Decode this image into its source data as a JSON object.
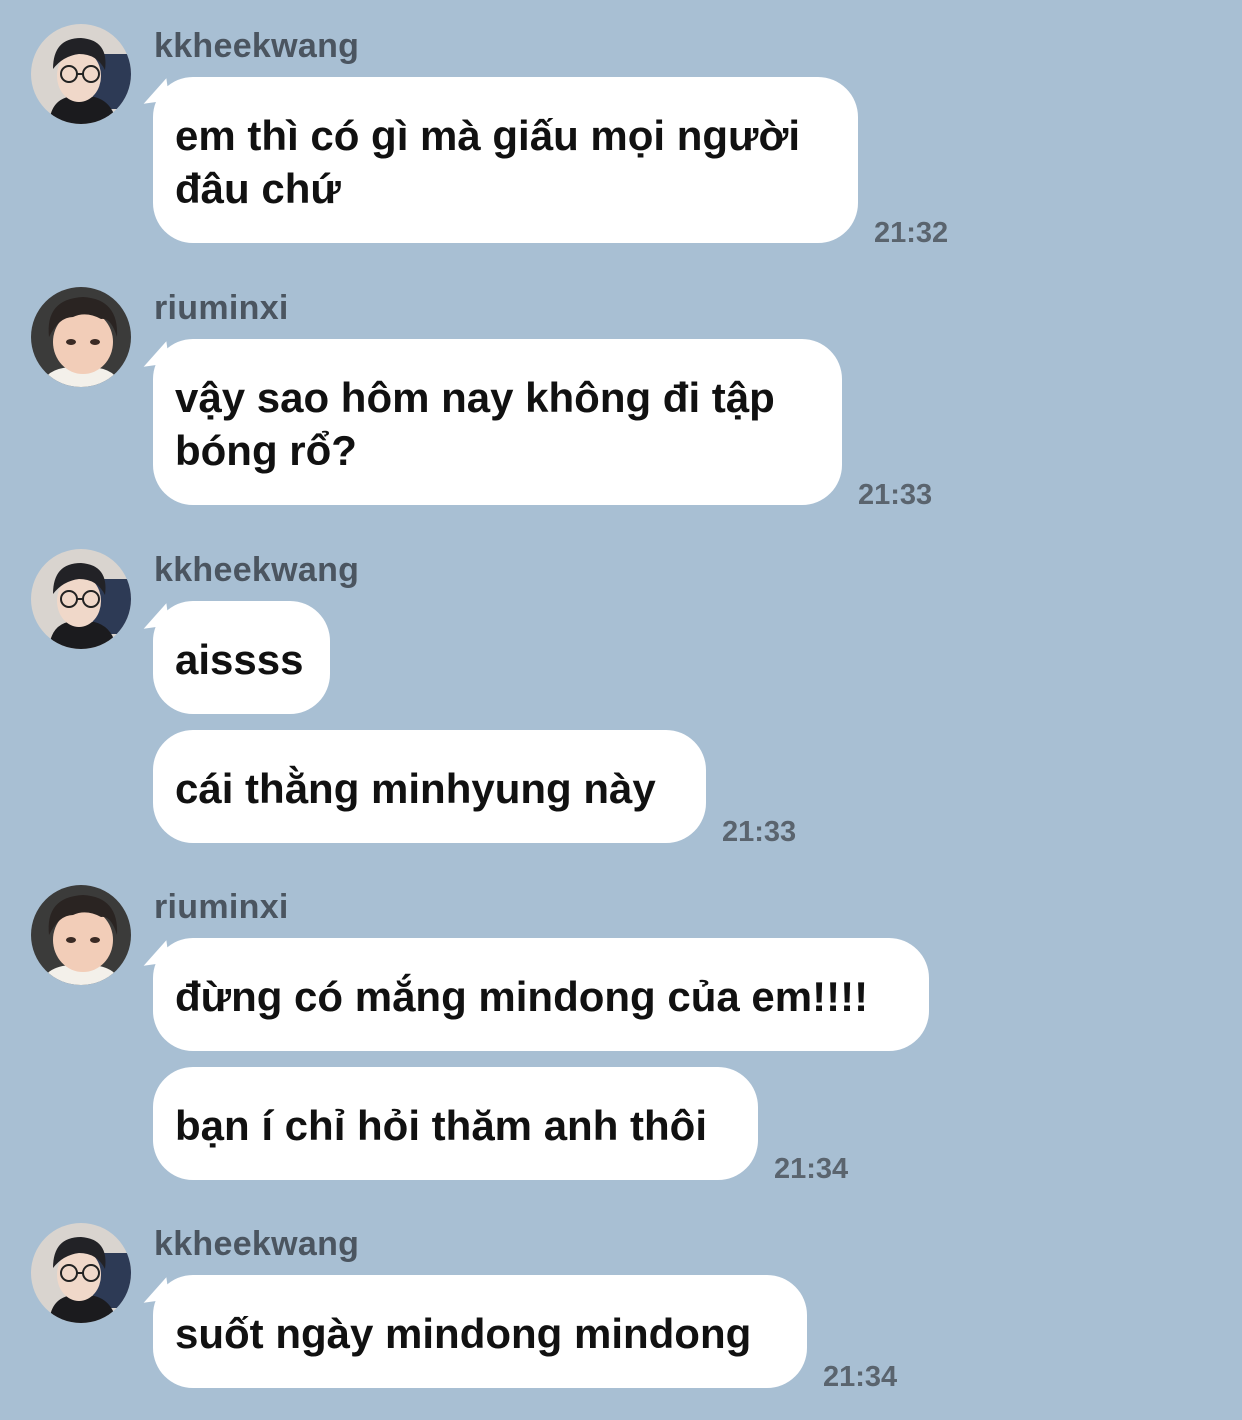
{
  "messages": [
    {
      "user": "kkheekwang",
      "texts": [
        "em thì có gì mà giấu mọi người\nđâu chứ"
      ],
      "time": "21:32",
      "avatar": "avatar-glasses"
    },
    {
      "user": "riuminxi",
      "texts": [
        "vậy sao hôm nay không đi tập\nbóng rổ?"
      ],
      "time": "21:33",
      "avatar": "avatar-face"
    },
    {
      "user": "kkheekwang",
      "texts": [
        "aissss",
        "cái thằng minhyung này"
      ],
      "time": "21:33",
      "avatar": "avatar-glasses"
    },
    {
      "user": "riuminxi",
      "texts": [
        "đừng có mắng mindong của em!!!!",
        "bạn í chỉ hỏi thăm anh thôi"
      ],
      "time": "21:34",
      "avatar": "avatar-face"
    },
    {
      "user": "kkheekwang",
      "texts": [
        "suốt ngày mindong mindong"
      ],
      "time": "21:34",
      "avatar": "avatar-glasses"
    }
  ]
}
